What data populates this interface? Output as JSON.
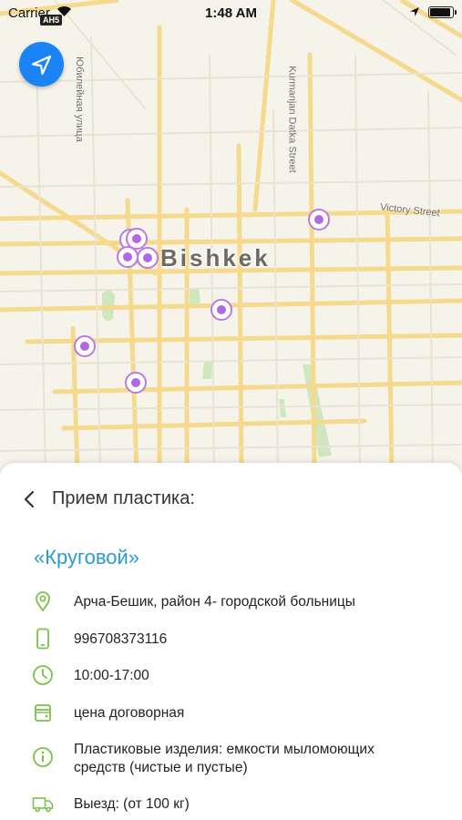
{
  "status_bar": {
    "carrier": "Carrier",
    "badge": "AH5",
    "time": "1:48 AM",
    "battery_level": 0.95
  },
  "map": {
    "city": "Bishkek",
    "streets": [
      "Юбилейная улица",
      "Kurmanjan Datka Street",
      "Victory Street"
    ],
    "marker_color": "#b169e3"
  },
  "sheet": {
    "title": "Прием пластика:",
    "place_name": "«Круговой»",
    "address": "Арча-Бешик, район 4- городской больницы",
    "phone": "996708373116",
    "hours": "10:00-17:00",
    "price": "цена договорная",
    "info_line1": "Пластиковые изделия: емкости мыломоющих",
    "info_line2": "средств (чистые и пустые)",
    "delivery": "Выезд: (от 100 кг)"
  },
  "colors": {
    "accent": "#2a9ad4",
    "icon_green": "#7bc24a",
    "locate_blue": "#1a84f5"
  }
}
